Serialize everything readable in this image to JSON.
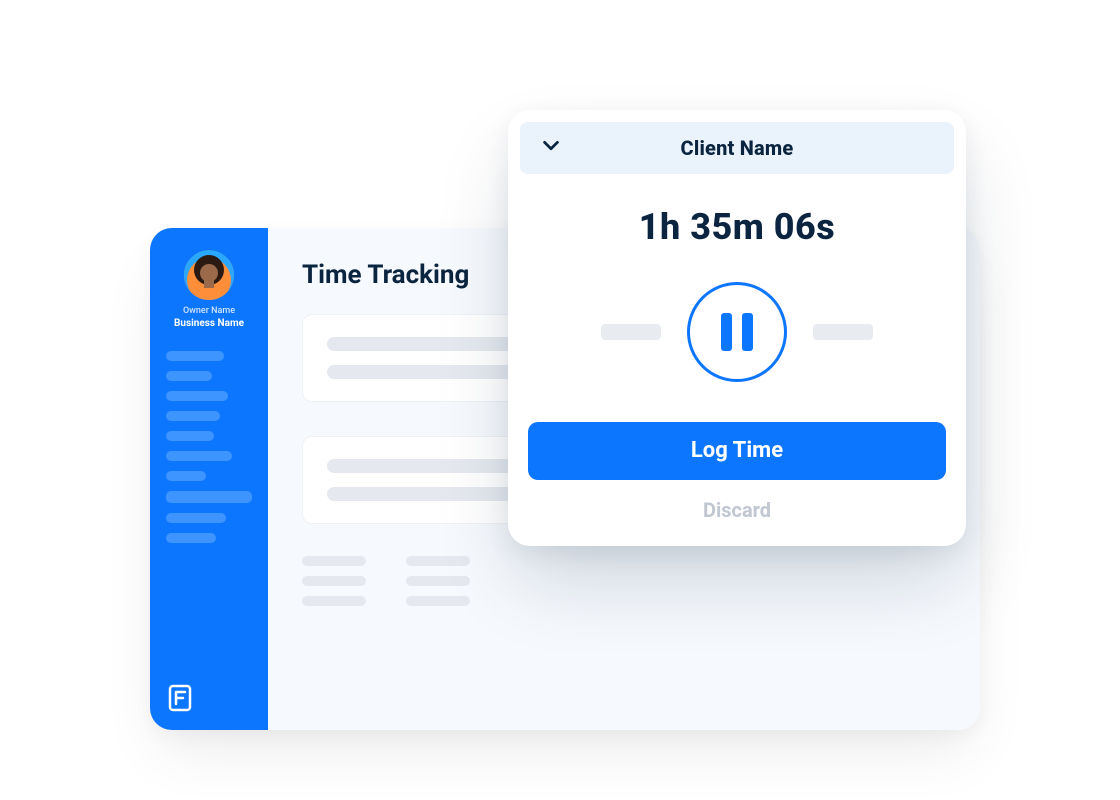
{
  "sidebar": {
    "owner_label": "Owner Name",
    "business_label": "Business Name"
  },
  "main": {
    "page_title": "Time Tracking"
  },
  "timer": {
    "client_label": "Client Name",
    "elapsed": "1h 35m 06s",
    "log_button": "Log Time",
    "discard_button": "Discard"
  },
  "colors": {
    "brand_blue": "#0d76ff",
    "dark_navy": "#0b2540",
    "header_bg": "#eaf2fb"
  }
}
